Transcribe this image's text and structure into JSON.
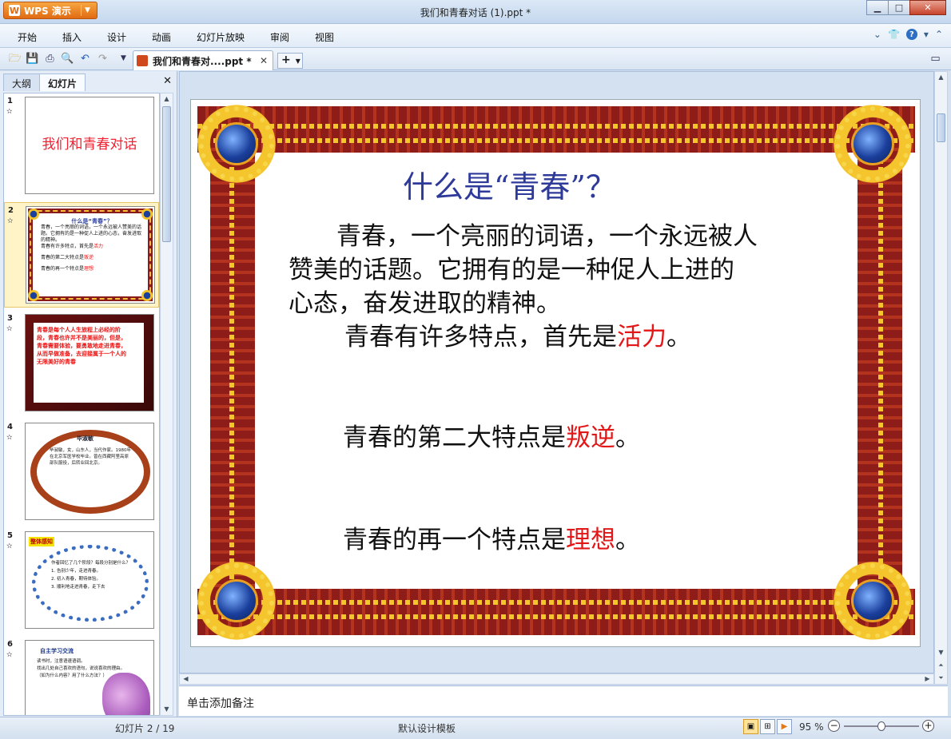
{
  "app": {
    "name": "WPS 演示",
    "window_title": "我们和青春对话 (1).ppt *",
    "menu": [
      "开始",
      "插入",
      "设计",
      "动画",
      "幻灯片放映",
      "审阅",
      "视图"
    ],
    "doc_tab": "我们和青春对....ppt *"
  },
  "panel": {
    "tabs": [
      "大纲",
      "幻灯片"
    ],
    "active_tab": "幻灯片",
    "slides": [
      {
        "num": "1",
        "title": "我们和青春对话"
      },
      {
        "num": "2",
        "title": "什么是“青春”？",
        "lines": [
          "青春，一个亮丽的词语，一个永远被人赞美的话题。它拥有的是一种促人上进的心态，奋发进取的精神。",
          "青春有许多特点，首先是",
          "活力",
          "青春的第二大特点是",
          "叛逆",
          "青春的再一个特点是",
          "理想"
        ]
      },
      {
        "num": "3",
        "text": "青春是每个人人生旅程上必经的阶段，青春也许并不是美丽的，但是，青春需要体验，要勇敢地走进青春，从而早做准备，去迎接属于一个人的无限美好的青春"
      },
      {
        "num": "4",
        "title": "毕淑敏",
        "text": "毕淑敏，女，山东人，当代作家。1980年在北京军医学校毕业。曾在西藏阿里高原部队服役，后转业回北京。"
      },
      {
        "num": "5",
        "title": "整体感知",
        "items": [
          "作者回忆了几个阶段？每段分别是什么？",
          "1. 告别少年，走进青春。",
          "2. 初入青春，期待体验。",
          "3. 顺利地走进青春，走下去"
        ]
      },
      {
        "num": "6",
        "title": "自主学习交流",
        "items": [
          "读书时，注意语速语调。",
          "找出几处自己喜欢的语句，说说喜欢的理由。",
          "（如为什么内容？用了什么方法？）"
        ]
      }
    ]
  },
  "slide": {
    "title": "什么是“青春”？",
    "para1": "青春，一个亮丽的词语，一个永远被人",
    "para2": "赞美的话题。它拥有的是一种促人上进的",
    "para3": "心态，奋发进取的精神。",
    "feat1_prefix": "青春有许多特点，首先是",
    "feat1_word": "活力",
    "feat2_prefix": "青春的第二大特点是",
    "feat2_word": "叛逆",
    "feat3_prefix": "青春的再一个特点是",
    "feat3_word": "理想",
    "period": "。"
  },
  "notes_placeholder": "单击添加备注",
  "status": {
    "slide_counter": "幻灯片 2 / 19",
    "template": "默认设计模板",
    "zoom": "95 %",
    "zoom_fraction": 0.5
  }
}
